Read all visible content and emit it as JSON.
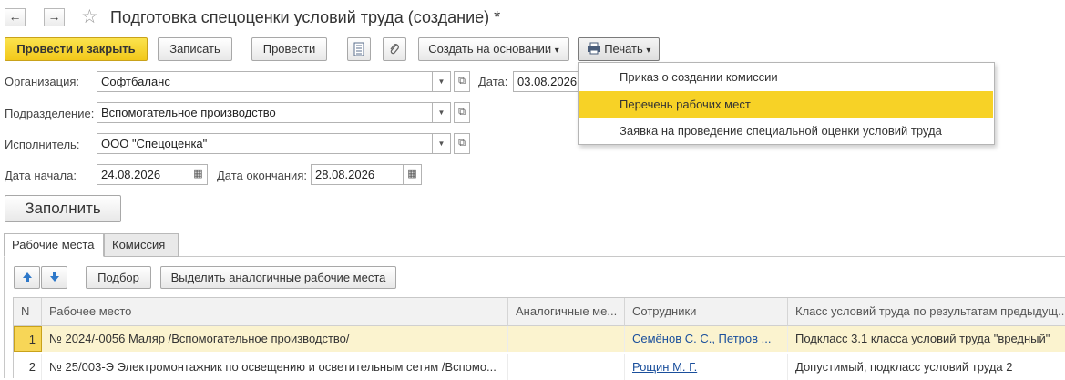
{
  "window": {
    "title": "Подготовка спецоценки условий труда (создание) *",
    "back_glyph": "←",
    "forward_glyph": "→",
    "star_glyph": "☆"
  },
  "toolbar": {
    "post_and_close": "Провести и закрыть",
    "write": "Записать",
    "post": "Провести",
    "create_based_on": "Создать на основании",
    "print": "Печать",
    "dropdown_glyph": "▾"
  },
  "print_menu": {
    "items": [
      "Приказ о создании комиссии",
      "Перечень рабочих мест",
      "Заявка на проведение специальной оценки условий труда"
    ],
    "highlight_color": "#f7d226"
  },
  "form": {
    "organization_label": "Организация:",
    "organization_value": "Софтбаланс",
    "date_label": "Дата:",
    "date_value": "03.08.2026",
    "department_label": "Подразделение:",
    "department_value": "Вспомогательное производство",
    "executor_label": "Исполнитель:",
    "executor_value": "ООО \"Спецоценка\"",
    "start_label": "Дата начала:",
    "start_value": "24.08.2026",
    "end_label": "Дата окончания:",
    "end_value": "28.08.2026",
    "fill_button": "Заполнить"
  },
  "tabs": {
    "workplaces": "Рабочие места",
    "commission": "Комиссия"
  },
  "table_toolbar": {
    "select": "Подбор",
    "highlight_similar": "Выделить аналогичные рабочие места"
  },
  "table": {
    "headers": {
      "n": "N",
      "workplace": "Рабочее место",
      "similar": "Аналогичные ме...",
      "employees": "Сотрудники",
      "class": "Класс условий труда по результатам предыдущ..."
    },
    "rows": [
      {
        "n": "1",
        "workplace": "№ 2024/-0056 Маляр /Вспомогательное производство/",
        "employees": "Семёнов С. С., Петров ...",
        "class": "Подкласс 3.1 класса условий труда \"вредный\""
      },
      {
        "n": "2",
        "workplace": "№ 25/003-Э Электромонтажник по освещению и осветительным сетям /Вспомо...",
        "employees": "Рощин М. Г.",
        "class": "Допустимый, подкласс условий труда 2"
      }
    ]
  }
}
